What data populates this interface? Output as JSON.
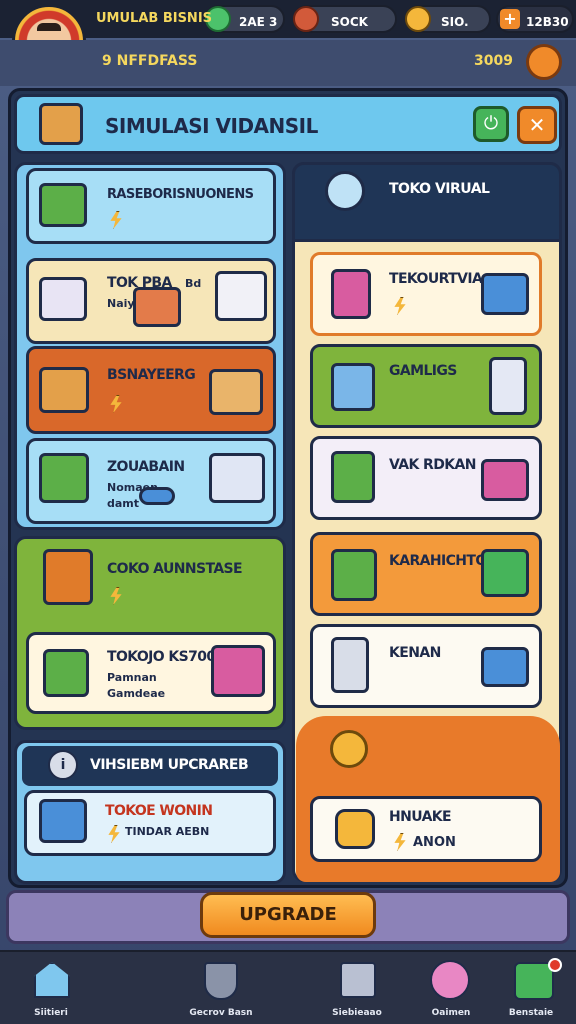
{
  "topbar": {
    "title": "UMULAB BISNIS",
    "gems": "2AE 3",
    "cash": "SOCK",
    "coins": "SIO.",
    "time": "12B30",
    "level": "9 NFFDFASS",
    "points": "3009"
  },
  "panel": {
    "title": "SIMULASI VIDANSIL",
    "confirm_icon": "power-icon",
    "close_icon": "close-icon"
  },
  "left": {
    "section1": {
      "header": "RASEBORISNUONENS",
      "items": [
        {
          "label": "TOK PBA",
          "extra": "Bd",
          "sub": "Naiy"
        },
        {
          "label": "BSNAYEERG"
        },
        {
          "label": "ZOUABAIN",
          "sub1": "Nomaen",
          "sub2": "damt"
        }
      ]
    },
    "section2": {
      "header": "COKO AUNNSTASE",
      "item": {
        "label": "TOKOJO KS700",
        "sub1": "Pamnan",
        "sub2": "Gamdeae"
      }
    },
    "section3": {
      "header": "VIHSIEBM UPCRAREB",
      "item": {
        "label": "TOKOE WONIN",
        "sub": "TINDAR AEBN"
      }
    }
  },
  "right": {
    "header": "TOKO VIRUAL",
    "items": [
      {
        "label": "TEKOURTVIA"
      },
      {
        "label": "GAMLIGS"
      },
      {
        "label": "VAK RDKAN"
      },
      {
        "label": "KARAHICHTO"
      },
      {
        "label": "KENAN"
      },
      {
        "label": "HNUAKE",
        "sub": "ANON"
      }
    ]
  },
  "upgrade_button": "UPGRADE",
  "nav": [
    {
      "label": "Siitieri"
    },
    {
      "label": "Gecrov Basn"
    },
    {
      "label": "Siebieaao"
    },
    {
      "label": "Oaimen"
    },
    {
      "label": "Benstaie"
    }
  ],
  "colors": {
    "sky": "#8fd0f2",
    "orange": "#e07b2a",
    "green": "#7fb43c",
    "navy": "#1f3556",
    "cream": "#f6e6b8",
    "upgrade": "#f59b2c"
  }
}
